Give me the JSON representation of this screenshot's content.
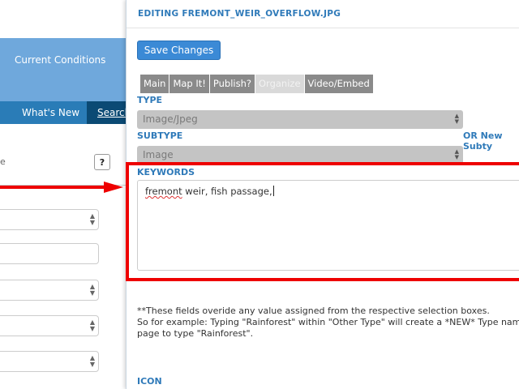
{
  "background": {
    "current_conditions": "Current Conditions",
    "whats_new": "What's New",
    "search": "Search",
    "panel_label": "e",
    "help": "?"
  },
  "modal": {
    "title": "EDITING FREMONT_WEIR_OVERFLOW.JPG",
    "save_label": "Save Changes",
    "tabs": [
      {
        "label": "Main"
      },
      {
        "label": "Map It!"
      },
      {
        "label": "Publish?"
      },
      {
        "label": "Organize",
        "active": true
      },
      {
        "label": "Video/Embed"
      }
    ],
    "type": {
      "label": "TYPE",
      "value": "Image/Jpeg"
    },
    "subtype": {
      "label": "SUBTYPE",
      "value": "Image",
      "or_new": "OR New Subty"
    },
    "keywords": {
      "label": "KEYWORDS",
      "value_misspelled": "fremont",
      "value_rest": " weir, fish passage,"
    },
    "note_line1": "**These fields overide any value assigned from the respective selection boxes.",
    "note_line2": "So for example: Typing \"Rainforest\" within \"Other Type\" will create a *NEW* Type named",
    "note_line3": "page to type \"Rainforest\".",
    "icon_label": "ICON"
  },
  "colors": {
    "accent": "#2f7ab9",
    "highlight": "#ee0000",
    "save_button": "#3b8ad6"
  }
}
